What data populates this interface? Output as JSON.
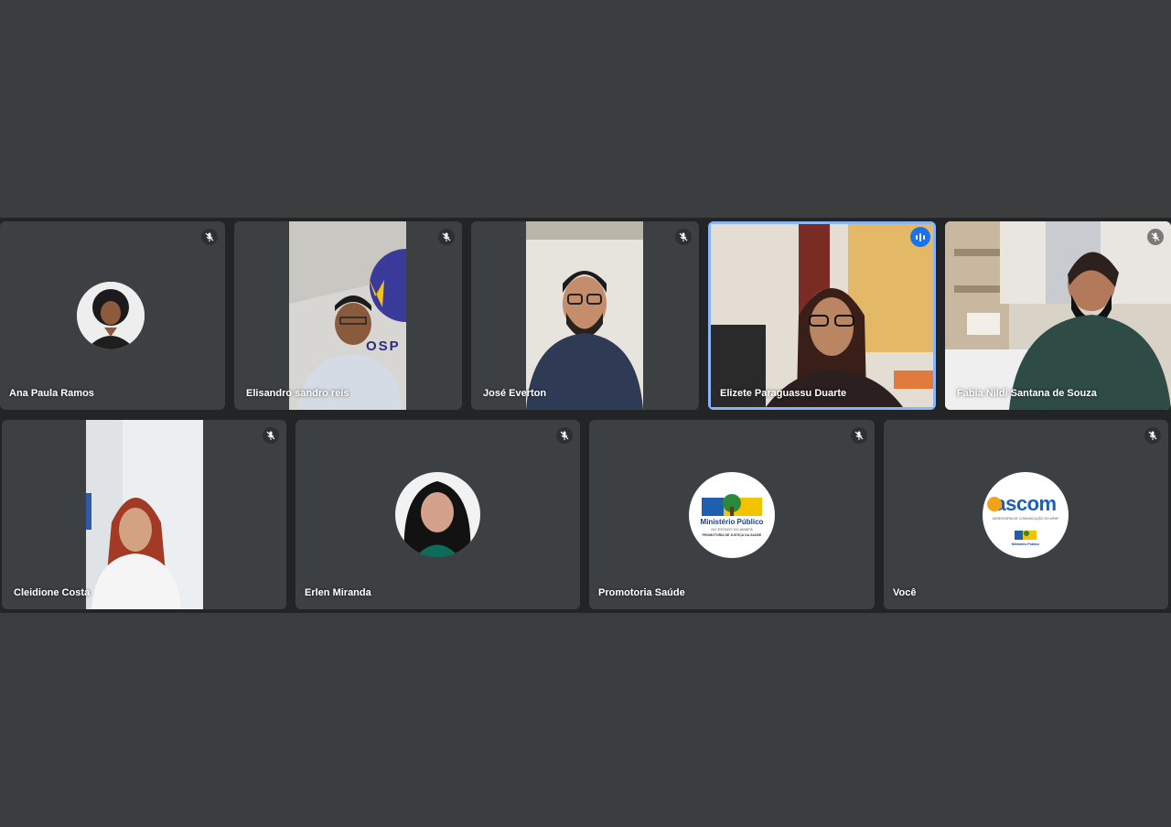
{
  "meeting": {
    "participants": [
      {
        "name": "Ana Paula Ramos",
        "muted": true
      },
      {
        "name": "Elisandro sandro reis",
        "muted": true,
        "banner_letters": "OSP"
      },
      {
        "name": "José Everton",
        "muted": true
      },
      {
        "name": "Elizete Paraguassu Duarte",
        "muted": false,
        "speaking": true
      },
      {
        "name": "Fabia Nildi Santana de Souza",
        "muted": true
      },
      {
        "name": "Cleidione Costa",
        "muted": true
      },
      {
        "name": "Erlen Miranda",
        "muted": true
      },
      {
        "name": "Promotoria Saúde",
        "muted": true,
        "logo": {
          "title": "Ministério Público",
          "subtitle": "DO ESTADO DO AMAPÁ",
          "footer": "PROMOTORIA DE JUSTIÇA DA SAÚDE"
        }
      },
      {
        "name": "Você",
        "muted": true,
        "logo": {
          "title": "ascom",
          "subtitle": "ASSESSORIA DE COMUNICAÇÃO DO MPAP",
          "footer": "Ministério Público"
        }
      }
    ]
  },
  "icons": {
    "muted": "mic-off-icon",
    "speaking": "audio-level-icon"
  },
  "colors": {
    "background": "#3b3c3e",
    "tile": "#3c4043",
    "active_border": "#8ab4f8",
    "speaking_badge": "#1a73e8"
  }
}
